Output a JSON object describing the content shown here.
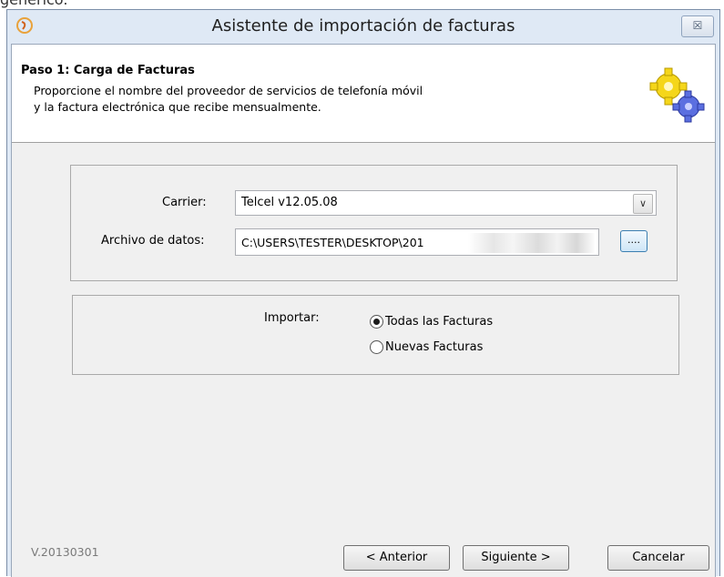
{
  "background_text": "genérico.",
  "window": {
    "title": "Asistente de importación de facturas",
    "close_label": "☒"
  },
  "header": {
    "step_title": "Paso 1: Carga de Facturas",
    "description_line1": "Proporcione el nombre del proveedor de servicios de telefonía móvil",
    "description_line2": "y la factura electrónica que recibe mensualmente."
  },
  "form": {
    "carrier_label": "Carrier:",
    "carrier_value": "Telcel v12.05.08",
    "file_label": "Archivo de datos:",
    "file_value": "C:\\USERS\\TESTER\\DESKTOP\\201",
    "browse_label": "...."
  },
  "import": {
    "label": "Importar:",
    "options": [
      {
        "label": "Todas las Facturas",
        "selected": true
      },
      {
        "label": "Nuevas Facturas",
        "selected": false
      }
    ]
  },
  "footer": {
    "version": "V.20130301",
    "prev_label": "< Anterior",
    "next_label": "Siguiente >",
    "cancel_label": "Cancelar"
  }
}
